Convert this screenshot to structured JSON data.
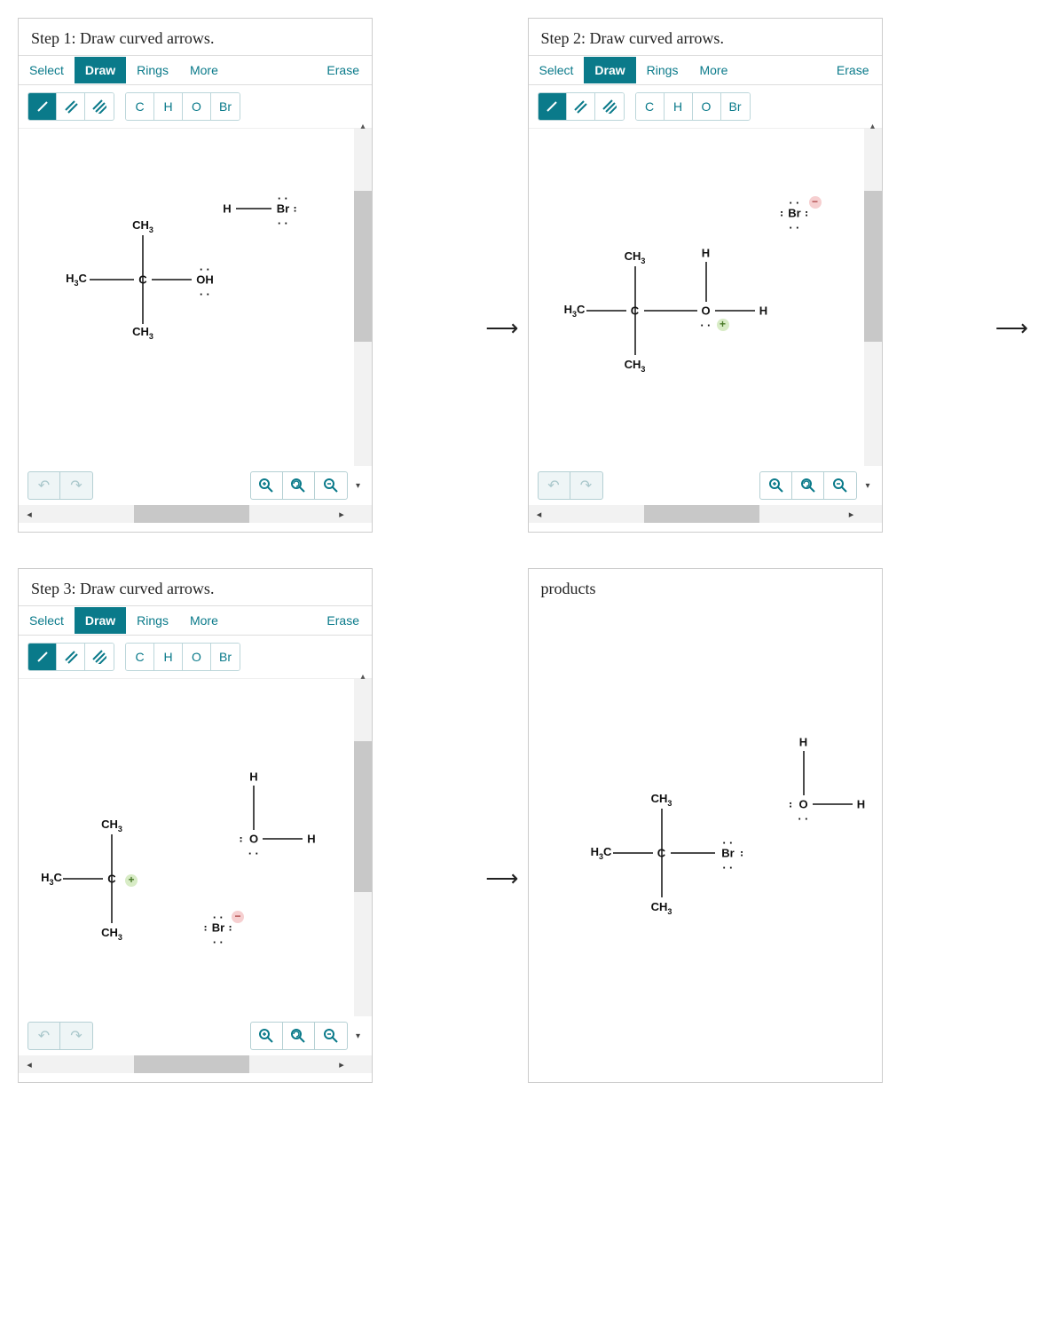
{
  "steps": [
    {
      "title": "Step 1: Draw curved arrows."
    },
    {
      "title": "Step 2: Draw curved arrows."
    },
    {
      "title": "Step 3: Draw curved arrows."
    },
    {
      "title": "products"
    }
  ],
  "toolbar": {
    "tabs": [
      "Select",
      "Draw",
      "Rings",
      "More"
    ],
    "active_tab": "Draw",
    "erase": "Erase",
    "atoms": [
      "C",
      "H",
      "O",
      "Br"
    ]
  },
  "arrow": "⟶",
  "molecules": {
    "step1": {
      "center": {
        "c": "C",
        "up": "CH₃",
        "down": "CH₃",
        "left": "H₃C",
        "right_label": "OH",
        "right_dots_top": "..",
        "right_dots_bot": ".."
      },
      "hbr": {
        "h": "H",
        "br": "Br",
        "br_dots": true
      }
    },
    "step2": {
      "center": {
        "c": "C",
        "up": "CH₃",
        "down": "CH₃",
        "left": "H₃C"
      },
      "oxygen": {
        "o": "O",
        "h_up": "H",
        "h_right": "H",
        "charge": "+",
        "dots_bot": ".."
      },
      "br": {
        "label": "Br",
        "charge": "−",
        "dots": true
      }
    },
    "step3": {
      "carbocation": {
        "c": "C",
        "up": "CH₃",
        "down": "CH₃",
        "left": "H₃C",
        "charge": "+"
      },
      "water": {
        "o": "O",
        "h_up": "H",
        "h_right": "H",
        "left_dots": ":",
        "dots_bot": ".."
      },
      "br": {
        "label": "Br",
        "charge": "−",
        "dots": true
      }
    },
    "products": {
      "tbu_br": {
        "c": "C",
        "up": "CH₃",
        "down": "CH₃",
        "left": "H₃C",
        "right": "Br",
        "right_dots_top": "..",
        "right_dots_bot": "..",
        "br_right_dots": ":"
      },
      "water": {
        "o": "O",
        "h_up": "H",
        "h_right": "H",
        "left_dots": ":",
        "dots_bot": ".."
      }
    }
  }
}
